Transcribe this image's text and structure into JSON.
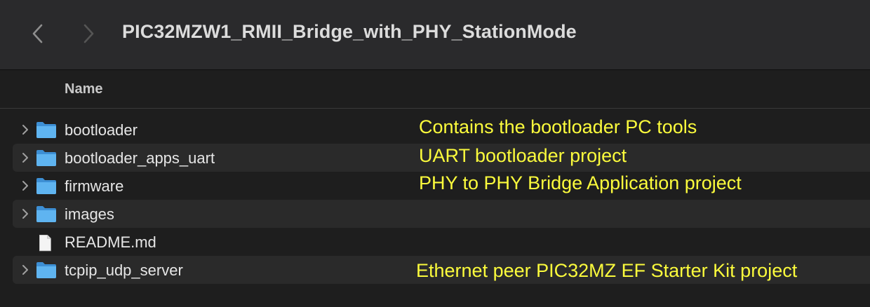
{
  "window": {
    "title": "PIC32MZW1_RMII_Bridge_with_PHY_StationMode"
  },
  "toolbar": {
    "back_icon": "chevron-left-icon",
    "forward_icon": "chevron-right-icon"
  },
  "columns": {
    "name_header": "Name"
  },
  "files": [
    {
      "name": "bootloader",
      "kind": "folder",
      "expandable": true
    },
    {
      "name": "bootloader_apps_uart",
      "kind": "folder",
      "expandable": true
    },
    {
      "name": "firmware",
      "kind": "folder",
      "expandable": true
    },
    {
      "name": "images",
      "kind": "folder",
      "expandable": true
    },
    {
      "name": "README.md",
      "kind": "document",
      "expandable": false
    },
    {
      "name": "tcpip_udp_server",
      "kind": "folder",
      "expandable": true
    }
  ],
  "annotations": [
    "Contains the bootloader PC tools",
    "UART bootloader project",
    "PHY to PHY Bridge Application project",
    "Ethernet peer PIC32MZ EF Starter Kit project"
  ],
  "colors": {
    "annotation": "#fbfb3c",
    "folder": "#5fb4f0",
    "background": "#1e1e1e",
    "toolbar": "#2a2a2c"
  }
}
